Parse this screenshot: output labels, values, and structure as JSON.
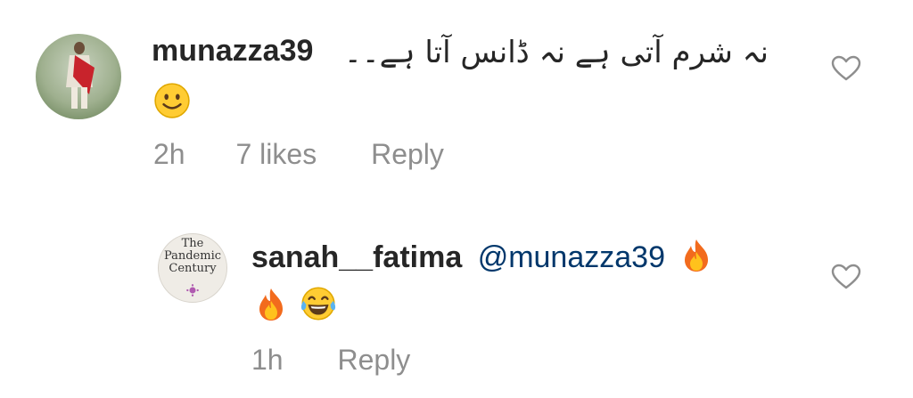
{
  "comments": [
    {
      "username": "munazza39",
      "text": "نہ شرم آتی ہے نہ ڈانس آتا ہے۔۔",
      "emoji": "slightly-smiling-face-emoji",
      "time": "2h",
      "likes": "7 likes",
      "reply_label": "Reply",
      "avatar_icon": "profile-avatar"
    },
    {
      "username": "sanah__fatima",
      "mention": "@munazza39",
      "emojis": [
        "fire-emoji",
        "fire-emoji",
        "tears-of-joy-emoji"
      ],
      "time": "1h",
      "reply_label": "Reply",
      "avatar_text": {
        "line1": "The",
        "line2": "Pandemic",
        "line3": "Century"
      }
    }
  ],
  "colors": {
    "username": "#262626",
    "meta": "#8e8e8e",
    "mention": "#00376b",
    "heart": "#8e8e8e"
  }
}
